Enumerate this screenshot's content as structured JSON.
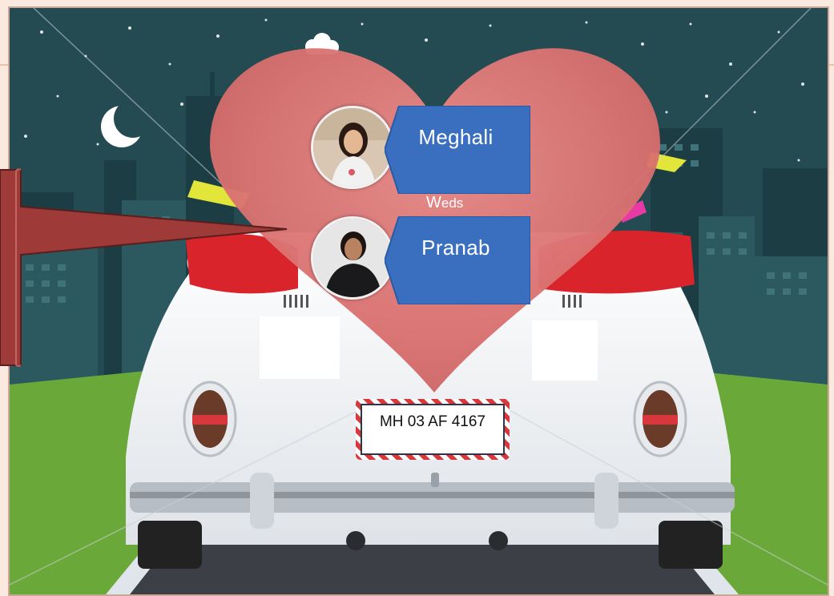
{
  "couple": {
    "bride_name": "Meghali",
    "weds_label": {
      "first": "W",
      "rest": "eds"
    },
    "groom_name": "Pranab"
  },
  "car": {
    "license_plate": "MH 03 AF 4167"
  },
  "colors": {
    "sky": "#244a52",
    "heart": "#d9706f",
    "name_box": "#3a6fc0",
    "callout": "#9e3b38",
    "grass": "#6aa83a",
    "road": "#3c4046",
    "car_body": "#f4f5f7"
  },
  "icons": [
    "moon-icon",
    "cloud-icon"
  ]
}
